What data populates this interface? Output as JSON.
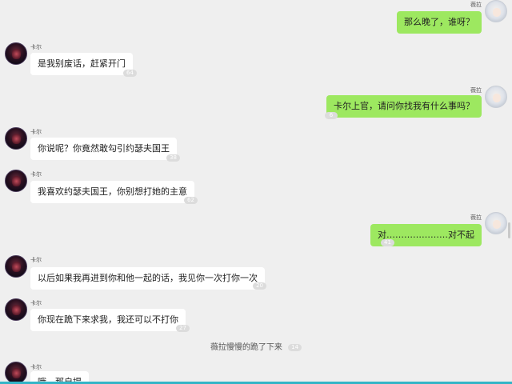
{
  "names": {
    "karl": "卡尔",
    "vera": "薇拉"
  },
  "messages": [
    {
      "side": "right",
      "text": "那么晚了，谁呀？",
      "count": ""
    },
    {
      "side": "left",
      "text": "是我别废话，赶紧开门",
      "count": "64"
    },
    {
      "side": "right",
      "text": "卡尔上官，请问你找我有什么事吗？",
      "count": "6"
    },
    {
      "side": "left",
      "text": "你说呢？你竟然敢勾引约瑟夫国王",
      "count": "38"
    },
    {
      "side": "left",
      "text": "我喜欢约瑟夫国王，你别想打她的主意",
      "count": "62"
    },
    {
      "side": "right",
      "text": "对…………………对不起",
      "count": "41"
    },
    {
      "side": "left",
      "text": "以后如果我再进到你和他一起的话，我见你一次打你一次",
      "count": "20"
    },
    {
      "side": "left",
      "text": "你现在跪下来求我，我还可以不打你",
      "count": "27"
    },
    {
      "side": "left",
      "text": "哦，那自提",
      "count": ""
    }
  ],
  "system_notice": {
    "text": "薇拉慢慢的跪了下来",
    "count": "14"
  },
  "colors": {
    "background": "#efefef",
    "bubble_left": "#ffffff",
    "bubble_right": "#9de860",
    "count_badge": "#dcdcdc",
    "bottom_bar": "#33b5c7"
  },
  "icons": {
    "karl_avatar": "karl-avatar",
    "vera_avatar": "vera-avatar"
  }
}
